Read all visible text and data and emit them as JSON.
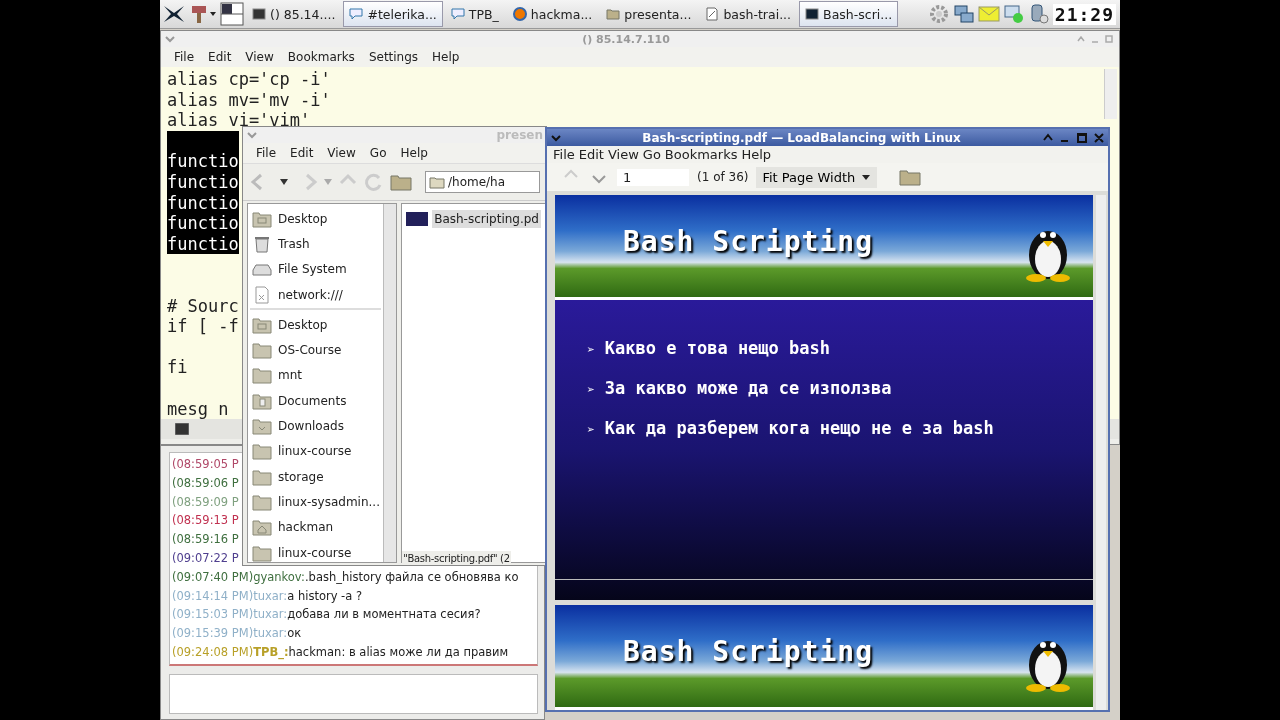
{
  "taskbar": {
    "tasks": [
      {
        "kind": "terminal",
        "label": "() 85.14....",
        "selected": false
      },
      {
        "kind": "chat",
        "label": "#telerika...",
        "selected": true
      },
      {
        "kind": "chat",
        "label": "TPB_",
        "selected": false
      },
      {
        "kind": "browser",
        "label": "hackma...",
        "selected": false
      },
      {
        "kind": "folder",
        "label": "presenta...",
        "selected": false
      },
      {
        "kind": "editor",
        "label": "bash-trai...",
        "selected": false
      },
      {
        "kind": "pdf",
        "label": "Bash-scri...",
        "selected": true
      }
    ],
    "clock": "21:29"
  },
  "terminal": {
    "title": "() 85.14.7.110",
    "menu": [
      "File",
      "Edit",
      "View",
      "Bookmarks",
      "Settings",
      "Help"
    ],
    "lines": [
      {
        "kind": "text",
        "text": "alias cp='cp -i'",
        "selected": false
      },
      {
        "kind": "text",
        "text": "alias mv='mv -i'",
        "selected": false
      },
      {
        "kind": "text",
        "text": "alias vi='vim'",
        "selected": false
      },
      {
        "kind": "blank",
        "selected": true
      },
      {
        "kind": "text",
        "text": "functio",
        "selected": true
      },
      {
        "kind": "text",
        "text": "functio",
        "selected": true
      },
      {
        "kind": "text",
        "text": "functio",
        "selected": true
      },
      {
        "kind": "text",
        "text": "functio",
        "selected": true
      },
      {
        "kind": "text",
        "text": "functio",
        "selected": true
      },
      {
        "kind": "blank"
      },
      {
        "kind": "blank"
      },
      {
        "kind": "text",
        "text": "# Sourc",
        "selected": false
      },
      {
        "kind": "text",
        "text": "if [ -f",
        "selected": false
      },
      {
        "kind": "blank"
      },
      {
        "kind": "text",
        "text": "fi",
        "selected": false
      },
      {
        "kind": "blank"
      },
      {
        "kind": "text",
        "text": "mesg n",
        "selected": false
      }
    ]
  },
  "chat": {
    "lines": [
      {
        "time": "(08:59:05 P",
        "color": "#b04868"
      },
      {
        "time": "(08:59:06 P",
        "color": "#3f6f3f"
      },
      {
        "time": "(08:59:09 P",
        "color": "#7fa07f"
      },
      {
        "time": "(08:59:13 P",
        "color": "#c0304f"
      },
      {
        "time": "(08:59:16 P",
        "color": "#3f6f3f"
      },
      {
        "time": "(09:07:22 P",
        "color": "#4f3f8f"
      },
      {
        "time": "(09:07:40 PM)",
        "nick": "gyankov:",
        "message": ".bash_history файла се обновява ко",
        "color": "#3f6f3f"
      },
      {
        "time": "(09:14:14 PM)",
        "nick": "tuxar:",
        "message": "a history -a ?",
        "color": "#8fb0c8"
      },
      {
        "time": "(09:15:03 PM)",
        "nick": "tuxar:",
        "message": "добава ли в моментната сесия?",
        "color": "#8fb0c8"
      },
      {
        "time": "(09:15:39 PM)",
        "nick": "tuxar:",
        "message": "ок",
        "color": "#8fb0c8"
      },
      {
        "time": "(09:24:08 PM)",
        "nick": "TPB_:",
        "message": "hackman:  в alias може ли да правим",
        "color": "#b8a028"
      }
    ]
  },
  "file_manager": {
    "title": "presen",
    "menu": [
      "File",
      "Edit",
      "View",
      "Go",
      "Help"
    ],
    "path": "/home/ha",
    "places": [
      {
        "kind": "desktop",
        "label": "Desktop"
      },
      {
        "kind": "trash",
        "label": "Trash"
      },
      {
        "kind": "drive",
        "label": "File System"
      },
      {
        "kind": "network",
        "label": "network:///"
      }
    ],
    "bookmarks": [
      {
        "kind": "desktop",
        "label": "Desktop"
      },
      {
        "kind": "folder",
        "label": "OS-Course"
      },
      {
        "kind": "folder",
        "label": "mnt"
      },
      {
        "kind": "documents",
        "label": "Documents"
      },
      {
        "kind": "downloads",
        "label": "Downloads"
      },
      {
        "kind": "folder",
        "label": "linux-course"
      },
      {
        "kind": "folder",
        "label": "storage"
      },
      {
        "kind": "folder",
        "label": "linux-sysadmin..."
      },
      {
        "kind": "home",
        "label": "hackman"
      },
      {
        "kind": "folder",
        "label": "linux-course"
      }
    ],
    "files": [
      {
        "name": "Bash-scripting.pd",
        "selected": true
      }
    ],
    "status": "\"Bash-scripting.pdf\" (2"
  },
  "pdf_viewer": {
    "title": "Bash-scripting.pdf — LoadBalancing with Linux",
    "menu": [
      "File",
      "Edit",
      "View",
      "Go",
      "Bookmarks",
      "Help"
    ],
    "page": "1",
    "page_count": "(1 of 36)",
    "zoom": "Fit Page Width",
    "pages": [
      {
        "title": "Bash Scripting",
        "bullets": [
          {
            "marker": "➢",
            "text": "Какво е това нещо bash"
          },
          {
            "marker": "➢",
            "text": "За какво може да се използва"
          },
          {
            "marker": "➢",
            "text": "Как да разберем кога нещо не е за bash"
          }
        ]
      },
      {
        "title": "Bash Scripting"
      }
    ]
  }
}
